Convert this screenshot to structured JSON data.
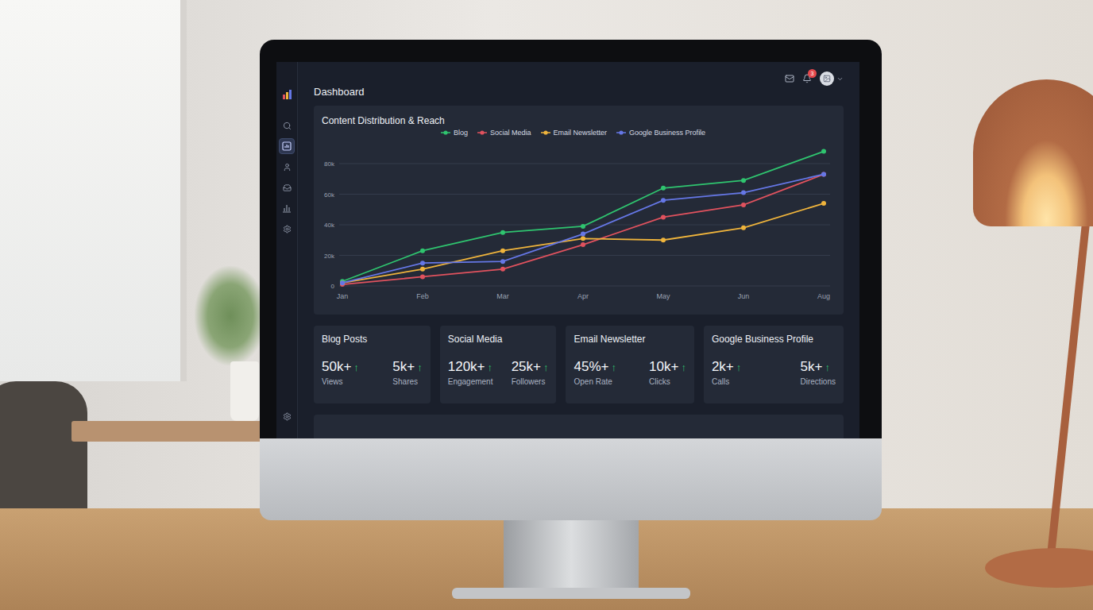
{
  "screen": {
    "title": "Dashboard",
    "notifications": "3"
  },
  "sidebar": {
    "items": [
      {
        "selected": false
      },
      {
        "selected": true
      },
      {
        "selected": false
      },
      {
        "selected": false
      },
      {
        "selected": false
      },
      {
        "selected": false
      }
    ],
    "footer": {
      "selected": false
    }
  },
  "chart": {
    "title": "Content Distribution & Reach",
    "y_ticks": [
      {
        "label": "0",
        "value": 0
      },
      {
        "label": "20k",
        "value": 20000
      },
      {
        "label": "40k",
        "value": 40000
      },
      {
        "label": "60k",
        "value": 60000
      },
      {
        "label": "80k",
        "value": 80000
      }
    ],
    "x_labels": [
      "Jan",
      "Feb",
      "Mar",
      "Apr",
      "May",
      "Jun",
      "Aug"
    ],
    "series": [
      {
        "name": "Blog",
        "color": "#2fc46f",
        "values": [
          3000,
          23000,
          35000,
          39000,
          64000,
          69000,
          88000
        ]
      },
      {
        "name": "Social Media",
        "color": "#e0525e",
        "values": [
          1000,
          6000,
          11000,
          27000,
          45000,
          53000,
          73000
        ]
      },
      {
        "name": "Email Newsletter",
        "color": "#efb43c",
        "values": [
          2000,
          11000,
          23000,
          31000,
          30000,
          38000,
          54000
        ]
      },
      {
        "name": "Google Business Profile",
        "color": "#6577e6",
        "values": [
          2000,
          15000,
          16000,
          34000,
          56000,
          61000,
          73000
        ]
      }
    ]
  },
  "stats": [
    {
      "title": "Blog Posts",
      "metrics": [
        {
          "value": "50k+",
          "trend": "↑",
          "label": "Views"
        },
        {
          "value": "5k+",
          "trend": "↑",
          "label": "Shares"
        }
      ]
    },
    {
      "title": "Social Media",
      "metrics": [
        {
          "value": "120k+",
          "trend": "↑",
          "label": "Engagement"
        },
        {
          "value": "25k+",
          "trend": "↑",
          "label": "Followers"
        }
      ]
    },
    {
      "title": "Email Newsletter",
      "metrics": [
        {
          "value": "45%+",
          "trend": "↑",
          "label": "Open Rate"
        },
        {
          "value": "10k+",
          "trend": "↑",
          "label": "Clicks"
        }
      ]
    },
    {
      "title": "Google Business Profile",
      "metrics": [
        {
          "value": "2k+",
          "trend": "↑",
          "label": "Calls"
        },
        {
          "value": "5k+",
          "trend": "↑",
          "label": "Directions"
        }
      ]
    }
  ]
}
